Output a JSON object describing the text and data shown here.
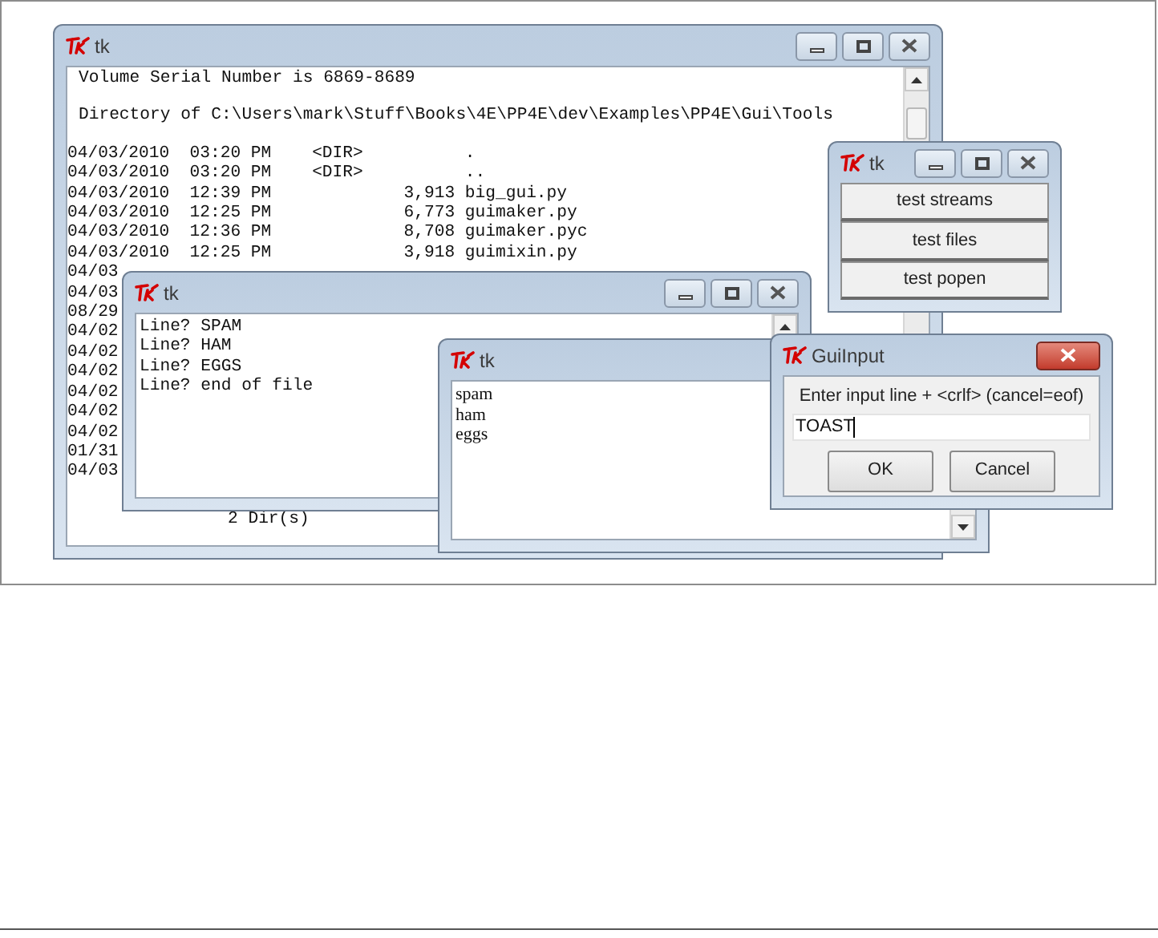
{
  "windows": [
    {
      "kind": "listing",
      "title": "tk",
      "header": [
        "Volume Serial Number is 6869-8689",
        "Directory of C:\\Users\\mark\\Stuff\\Books\\4E\\PP4E\\dev\\Examples\\PP4E\\Gui\\Tools"
      ],
      "rows": [
        "04/03/2010  03:20 PM    <DIR>          .",
        "04/03/2010  03:20 PM    <DIR>          ..",
        "04/03/2010  12:39 PM             3,913 big_gui.py",
        "04/03/2010  12:25 PM             6,773 guimaker.py",
        "04/03/2010  12:36 PM             8,708 guimaker.pyc",
        "04/03/2010  12:25 PM             3,918 guimixin.py"
      ],
      "cut_rows": [
        "04/03",
        "04/03",
        "08/29",
        "04/02",
        "04/02",
        "04/02",
        "04/02",
        "04/02",
        "04/02",
        "01/31",
        "04/03"
      ],
      "footer": "2 Dir(s)"
    },
    {
      "kind": "buttons",
      "title": "tk",
      "buttons": [
        "test streams",
        "test files",
        "test popen"
      ]
    },
    {
      "kind": "log",
      "title": "tk",
      "lines": [
        "Line? SPAM",
        "Line? HAM",
        "Line? EGGS",
        "Line? end of file"
      ]
    },
    {
      "kind": "editor",
      "title": "tk",
      "lines": [
        "spam",
        "ham",
        "eggs"
      ]
    },
    {
      "kind": "dialog",
      "title": "GuiInput",
      "prompt": "Enter input line + <crlf> (cancel=eof)",
      "value": "TOAST",
      "buttons": [
        "OK",
        "Cancel"
      ]
    }
  ]
}
